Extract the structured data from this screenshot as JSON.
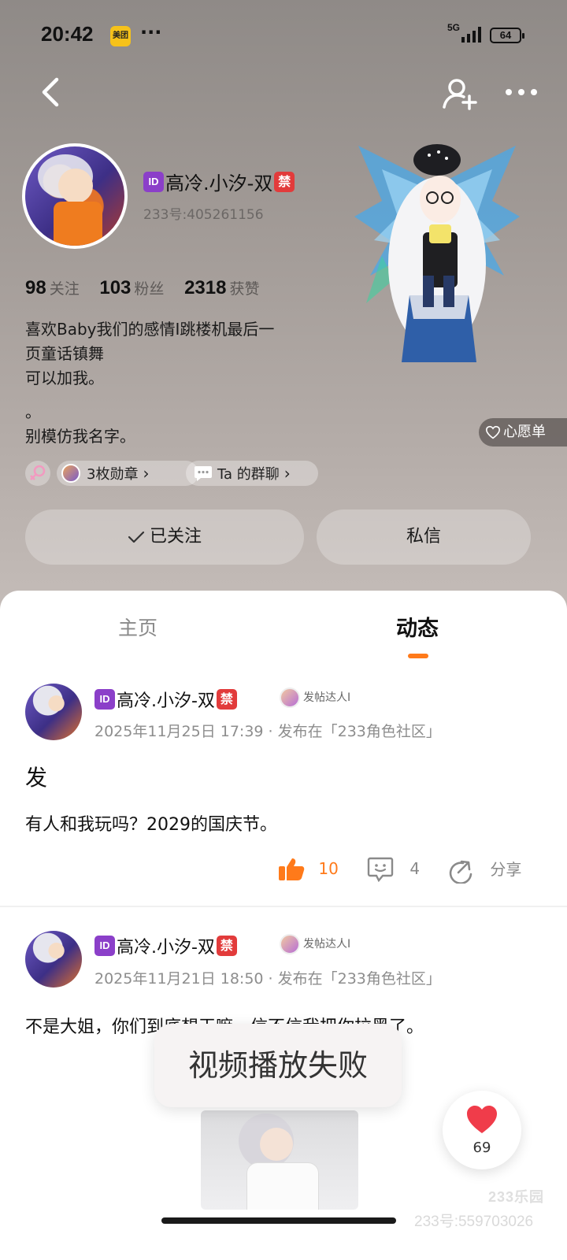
{
  "status_bar": {
    "time": "20:42",
    "app_icon_text": "美团",
    "more_dots": "···",
    "network": "5G",
    "battery": "64"
  },
  "profile": {
    "id_badge": "ID",
    "ban_badge": "禁",
    "name": "高冷.小汐-双",
    "uid": "233号:405261156",
    "stats": [
      {
        "value": "98",
        "label": "关注"
      },
      {
        "value": "103",
        "label": "粉丝"
      },
      {
        "value": "2318",
        "label": "获赞"
      }
    ],
    "bio_lines": [
      "喜欢Baby我们的感情I跳楼机最后一",
      "页童话镇舞",
      "可以加我。",
      "",
      "。",
      "别模仿我名字。"
    ],
    "wishlist": "心愿单",
    "medals": "3枚勋章",
    "group_chat": "Ta 的群聊",
    "follow_status": "已关注",
    "message": "私信"
  },
  "tabs": {
    "home": "主页",
    "posts": "动态"
  },
  "posts": [
    {
      "author": "高冷.小汐-双",
      "badge": "发帖达人I",
      "meta": "2025年11月25日 17:39 · 发布在「233角色社区」",
      "title": "发",
      "body": "有人和我玩吗？2029的国庆节。",
      "likes": "10",
      "comments": "4",
      "share": "分享"
    },
    {
      "author": "高冷.小汐-双",
      "badge": "发帖达人I",
      "meta": "2025年11月21日 18:50 · 发布在「233角色社区」",
      "body": "不是大姐，你们到底想干嘛，信不信我把你拉黑了。"
    }
  ],
  "toast": "视频播放失败",
  "favorite_count": "69",
  "watermark": {
    "logo": "233乐园",
    "id": "233号:559703026"
  },
  "colors": {
    "accent": "#ff7a1a",
    "id_badge": "#8b3fc9",
    "ban_badge": "#e23b3b",
    "like_heart": "#f03c4a"
  }
}
